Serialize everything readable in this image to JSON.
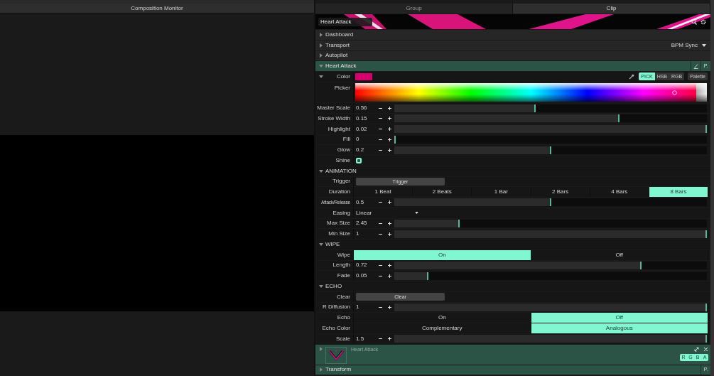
{
  "monitor": {
    "title": "Composition Monitor"
  },
  "tabs": [
    {
      "label": "Group",
      "selected": false
    },
    {
      "label": "Clip",
      "selected": true
    }
  ],
  "clip_header": {
    "search_value": "Heart Attack"
  },
  "rows": [
    {
      "kind": "section",
      "label": "Dashboard",
      "expanded": false
    },
    {
      "kind": "section",
      "label": "Transport",
      "expanded": false,
      "dropdown": "BPM Sync"
    },
    {
      "kind": "section",
      "label": "Autopilot",
      "expanded": false
    },
    {
      "kind": "layer",
      "label": "Heart Attack",
      "expanded": true,
      "buttons": [
        {
          "kind": "angle"
        },
        {
          "kind": "text",
          "label": "P."
        }
      ]
    },
    {
      "kind": "color",
      "label": "Color",
      "expanded": true,
      "color": "#d6006e",
      "modes": [
        {
          "label": "PICK",
          "selected": true
        },
        {
          "label": "HSB",
          "selected": false
        },
        {
          "label": "RGB",
          "selected": false
        }
      ],
      "palette": "Palette"
    },
    {
      "kind": "picker",
      "label": "Picker"
    },
    {
      "kind": "slider",
      "label": "Master Scale",
      "value": "0.56",
      "level": 0.45
    },
    {
      "kind": "slider",
      "label": "Stroke Width",
      "value": "0.15",
      "level": 0.72
    },
    {
      "kind": "slider",
      "label": "Highlight",
      "value": "0.02",
      "level": 1
    },
    {
      "kind": "slider",
      "label": "Fill",
      "value": "0",
      "level": 0
    },
    {
      "kind": "slider",
      "label": "Glow",
      "value": "0.2",
      "level": 0.5
    },
    {
      "kind": "checkbox",
      "label": "Shine",
      "checked": true
    },
    {
      "kind": "group",
      "label": "ANIMATION",
      "expanded": true
    },
    {
      "kind": "button",
      "label": "Trigger",
      "button": "Trigger"
    },
    {
      "kind": "segmented",
      "label": "Duration",
      "options": [
        {
          "label": "1 Beat",
          "selected": false
        },
        {
          "label": "2 Beats",
          "selected": false
        },
        {
          "label": "1 Bar",
          "selected": false
        },
        {
          "label": "2 Bars",
          "selected": false
        },
        {
          "label": "4 Bars",
          "selected": false
        },
        {
          "label": "8 Bars",
          "selected": true
        }
      ]
    },
    {
      "kind": "slider",
      "label": "Attack/Release",
      "value": "0.5",
      "level": 0.5,
      "small": true
    },
    {
      "kind": "dropdown",
      "label": "Easing",
      "value": "Linear"
    },
    {
      "kind": "slider",
      "label": "Max Size",
      "value": "2.45",
      "level": 0.205
    },
    {
      "kind": "slider",
      "label": "Min Size",
      "value": "1",
      "level": 1
    },
    {
      "kind": "group",
      "label": "WIPE",
      "expanded": true
    },
    {
      "kind": "segmented",
      "label": "Wipe",
      "options": [
        {
          "label": "On",
          "selected": true
        },
        {
          "label": "Off",
          "selected": false
        }
      ]
    },
    {
      "kind": "slider",
      "label": "Length",
      "value": "0.72",
      "level": 0.79
    },
    {
      "kind": "slider",
      "label": "Fade",
      "value": "0.05",
      "level": 0.105
    },
    {
      "kind": "group",
      "label": "ECHO",
      "expanded": true
    },
    {
      "kind": "button",
      "label": "Clear",
      "button": "Clear"
    },
    {
      "kind": "slider",
      "label": "R Diffusion",
      "value": "1",
      "level": 1
    },
    {
      "kind": "segmented",
      "label": "Echo",
      "options": [
        {
          "label": "On",
          "selected": false
        },
        {
          "label": "Off",
          "selected": true
        }
      ]
    },
    {
      "kind": "segmented",
      "label": "Echo Color",
      "options": [
        {
          "label": "Complementary",
          "selected": false
        },
        {
          "label": "Analogous",
          "selected": true
        }
      ]
    },
    {
      "kind": "slider",
      "label": "Scale",
      "value": "1.5",
      "level": 1
    },
    {
      "kind": "clip",
      "label": "Heart Attack",
      "expanded": false,
      "channels": [
        {
          "label": "R",
          "on": true
        },
        {
          "label": "G",
          "on": true
        },
        {
          "label": "B",
          "on": true
        },
        {
          "label": "A",
          "on": true
        }
      ]
    },
    {
      "kind": "layer",
      "label": "Transform",
      "expanded": false,
      "buttons": [
        {
          "kind": "text",
          "label": "P."
        }
      ]
    }
  ]
}
